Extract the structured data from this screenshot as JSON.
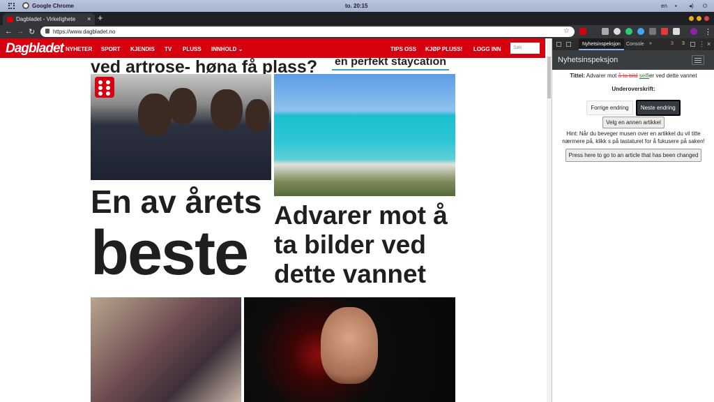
{
  "os": {
    "app_name": "Google Chrome",
    "clock": "to. 20:15",
    "lang": "en"
  },
  "browser": {
    "tab_title": "Dagbladet - Virkelighete",
    "url": "https://www.dagbladet.no"
  },
  "site": {
    "logo": "Dagbladet",
    "nav": [
      "NYHETER",
      "SPORT",
      "KJENDIS",
      "TV",
      "PLUSS",
      "INNHOLD ⌄"
    ],
    "nav_right": [
      "TIPS OSS",
      "KJØP PLUSS!",
      "LOGG INN"
    ],
    "search_placeholder": "Søk",
    "partial_headline": "ved artrose- høna få plass?",
    "staycation": "en perfekt staycation",
    "headline1_a": "En av årets",
    "headline1_b": "beste",
    "headline2": "Advarer mot å ta bilder ved dette vannet"
  },
  "devtools": {
    "tab_active": "Nyhetsinspeksjon",
    "tab_console": "Console",
    "more": "»",
    "errors": "3",
    "warnings": "3"
  },
  "panel": {
    "title": "Nyhetsinspeksjon",
    "tittel_label": "Tittel:",
    "tittel_prefix": "Advarer mot",
    "tittel_removed": "å ta bild",
    "tittel_added": "selfi",
    "tittel_suffix": "er ved dette vannet",
    "subheading_label": "Underoverskrift:",
    "prev_button": "Forrige endring",
    "next_button": "Neste endring",
    "choose_button": "Velg en annen artikkel",
    "hint": "Hint: Når du beveger musen over en artikkel du vil titte nærmere på, klikk s på tastaturet for å fukusere på saken!",
    "press_button": "Press here to go to an article that has been changed"
  }
}
